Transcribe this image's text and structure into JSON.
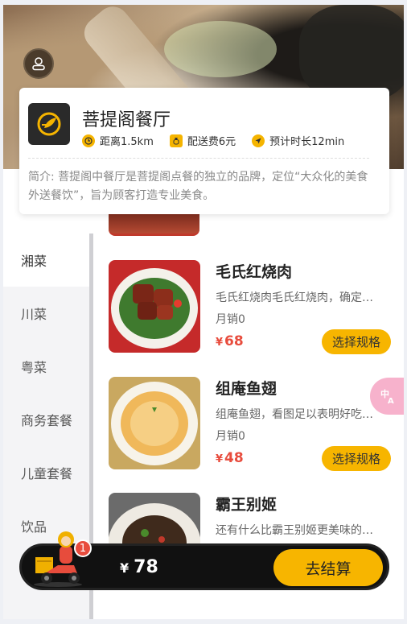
{
  "shop": {
    "name": "菩提阁餐厅",
    "distance": "距离1.5km",
    "delivery_fee": "配送费6元",
    "eta": "预计时长12min",
    "intro": "简介: 菩提阁中餐厅是菩提阁点餐的独立的品牌，定位“大众化的美食外送餐饮”，旨为顾客打造专业美食。"
  },
  "categories": [
    {
      "label": "湘菜",
      "active": true
    },
    {
      "label": "川菜",
      "active": false
    },
    {
      "label": "粤菜",
      "active": false
    },
    {
      "label": "商务套餐",
      "active": false
    },
    {
      "label": "儿童套餐",
      "active": false
    },
    {
      "label": "饮品",
      "active": false
    }
  ],
  "dishes": [
    {
      "name": "毛氏红烧肉",
      "desc": "毛氏红烧肉毛氏红烧肉，确定不来一份？",
      "sales": "月销0",
      "currency": "¥",
      "price": "68",
      "button": "选择规格"
    },
    {
      "name": "组庵鱼翅",
      "desc": "组庵鱼翅，看图足以表明好吃程度",
      "sales": "月销0",
      "currency": "¥",
      "price": "48",
      "button": "选择规格"
    },
    {
      "name": "霸王别姬",
      "desc": "还有什么比霸王别姬更美味的呢？",
      "sales": "",
      "currency": "",
      "price": "",
      "button": ""
    }
  ],
  "cart": {
    "count": "1",
    "currency": "¥",
    "total": "78",
    "checkout_label": "去结算"
  },
  "colors": {
    "accent": "#f7b500",
    "price": "#e84c3d",
    "cart_bg": "#111111"
  },
  "icons": {
    "avatar": "user-icon",
    "distance": "clock-icon",
    "fee": "money-bag-icon",
    "eta": "navigation-arrow-icon",
    "translate": "translate-icon"
  }
}
